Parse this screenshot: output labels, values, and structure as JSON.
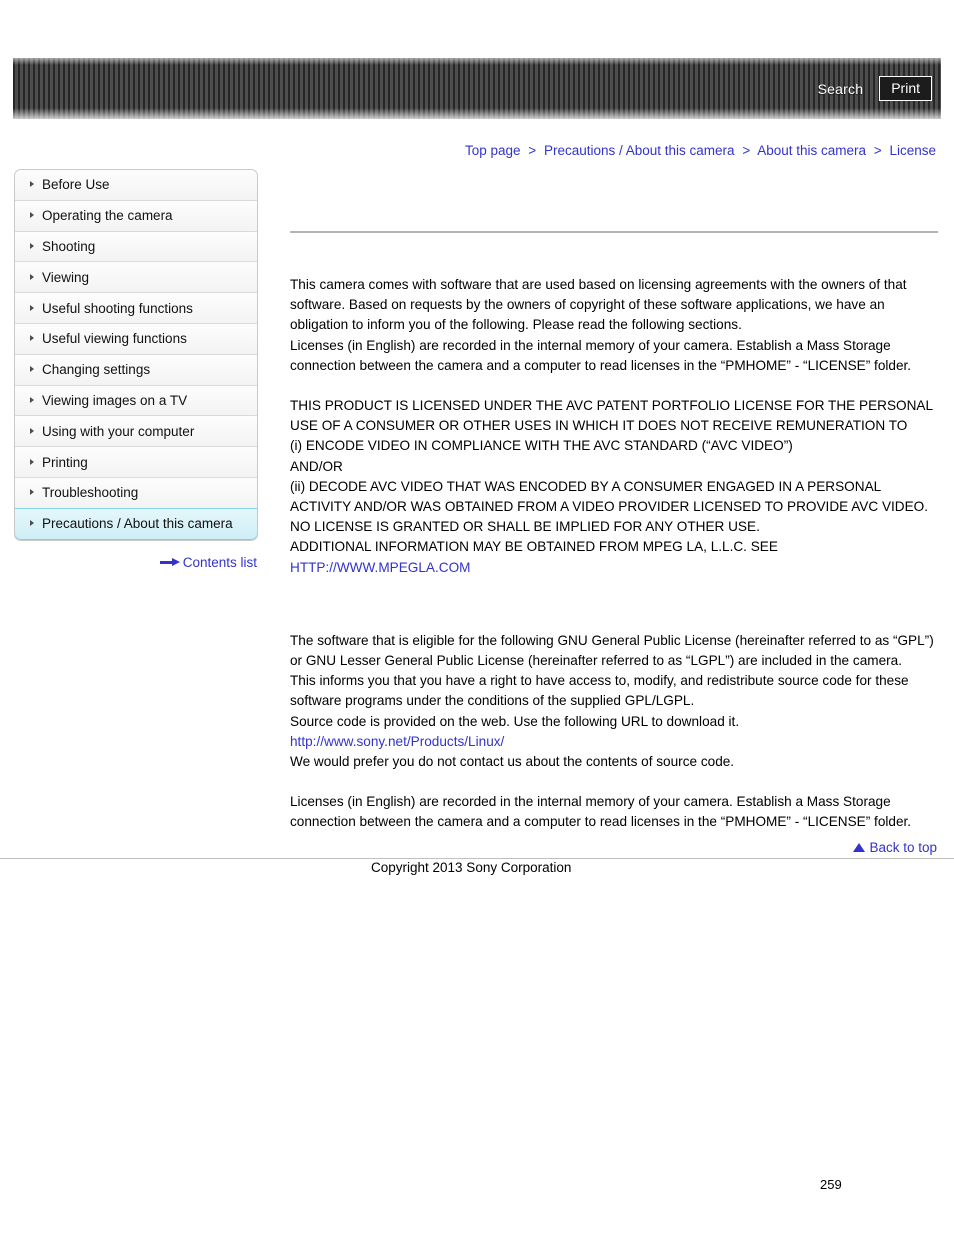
{
  "header": {
    "search_label": "Search",
    "print_label": "Print"
  },
  "breadcrumb": {
    "separator": ">",
    "items": [
      {
        "label": "Top page"
      },
      {
        "label": "Precautions / About this camera"
      },
      {
        "label": "About this camera"
      },
      {
        "label": "License"
      }
    ]
  },
  "sidebar": {
    "items": [
      {
        "label": "Before Use",
        "selected": false
      },
      {
        "label": "Operating the camera",
        "selected": false
      },
      {
        "label": "Shooting",
        "selected": false
      },
      {
        "label": "Viewing",
        "selected": false
      },
      {
        "label": "Useful shooting functions",
        "selected": false
      },
      {
        "label": "Useful viewing functions",
        "selected": false
      },
      {
        "label": "Changing settings",
        "selected": false
      },
      {
        "label": "Viewing images on a TV",
        "selected": false
      },
      {
        "label": "Using with your computer",
        "selected": false
      },
      {
        "label": "Printing",
        "selected": false
      },
      {
        "label": "Troubleshooting",
        "selected": false
      },
      {
        "label": "Precautions / About this camera",
        "selected": true
      }
    ],
    "contents_list_label": "Contents list"
  },
  "content": {
    "title": "",
    "para_intro": "This camera comes with software that are used based on licensing agreements with the owners of that software. Based on requests by the owners of copyright of these software applications, we have an obligation to inform you of the following. Please read the following sections.\nLicenses (in English) are recorded in the internal memory of your camera. Establish a Mass Storage connection between the camera and a computer to read licenses in the “PMHOME” - “LICENSE” folder.",
    "para_avc": "THIS PRODUCT IS LICENSED UNDER THE AVC PATENT PORTFOLIO LICENSE FOR THE PERSONAL USE OF A CONSUMER OR OTHER USES IN WHICH IT DOES NOT RECEIVE REMUNERATION TO\n(i) ENCODE VIDEO IN COMPLIANCE WITH THE AVC STANDARD (“AVC VIDEO”)\nAND/OR\n(ii) DECODE AVC VIDEO THAT WAS ENCODED BY A CONSUMER ENGAGED IN A PERSONAL ACTIVITY AND/OR WAS OBTAINED FROM A VIDEO PROVIDER LICENSED TO PROVIDE AVC VIDEO.\nNO LICENSE IS GRANTED OR SHALL BE IMPLIED FOR ANY OTHER USE.\nADDITIONAL INFORMATION MAY BE OBTAINED FROM MPEG LA, L.L.C. SEE\n",
    "link_mpegla": "HTTP://WWW.MPEGLA.COM",
    "para_gpl": "The software that is eligible for the following GNU General Public License (hereinafter referred to as “GPL”) or GNU Lesser General Public License (hereinafter referred to as “LGPL”) are included in the camera.\nThis informs you that you have a right to have access to, modify, and redistribute source code for these software programs under the conditions of the supplied GPL/LGPL.\nSource code is provided on the web. Use the following URL to download it.\n",
    "link_sony_linux": "http://www.sony.net/Products/Linux/",
    "para_gpl_tail": "\nWe would prefer you do not contact us about the contents of source code.",
    "para_final": "Licenses (in English) are recorded in the internal memory of your camera. Establish a Mass Storage connection between the camera and a computer to read licenses in the “PMHOME” - “LICENSE” folder."
  },
  "footer": {
    "back_to_top_label": "Back to top",
    "copyright": "Copyright 2013 Sony Corporation",
    "page_number": "259"
  },
  "colors": {
    "link": "#3333cc",
    "header_dark": "#262626",
    "header_light": "#4e4e4e",
    "selected_nav": "#cfeef6"
  }
}
